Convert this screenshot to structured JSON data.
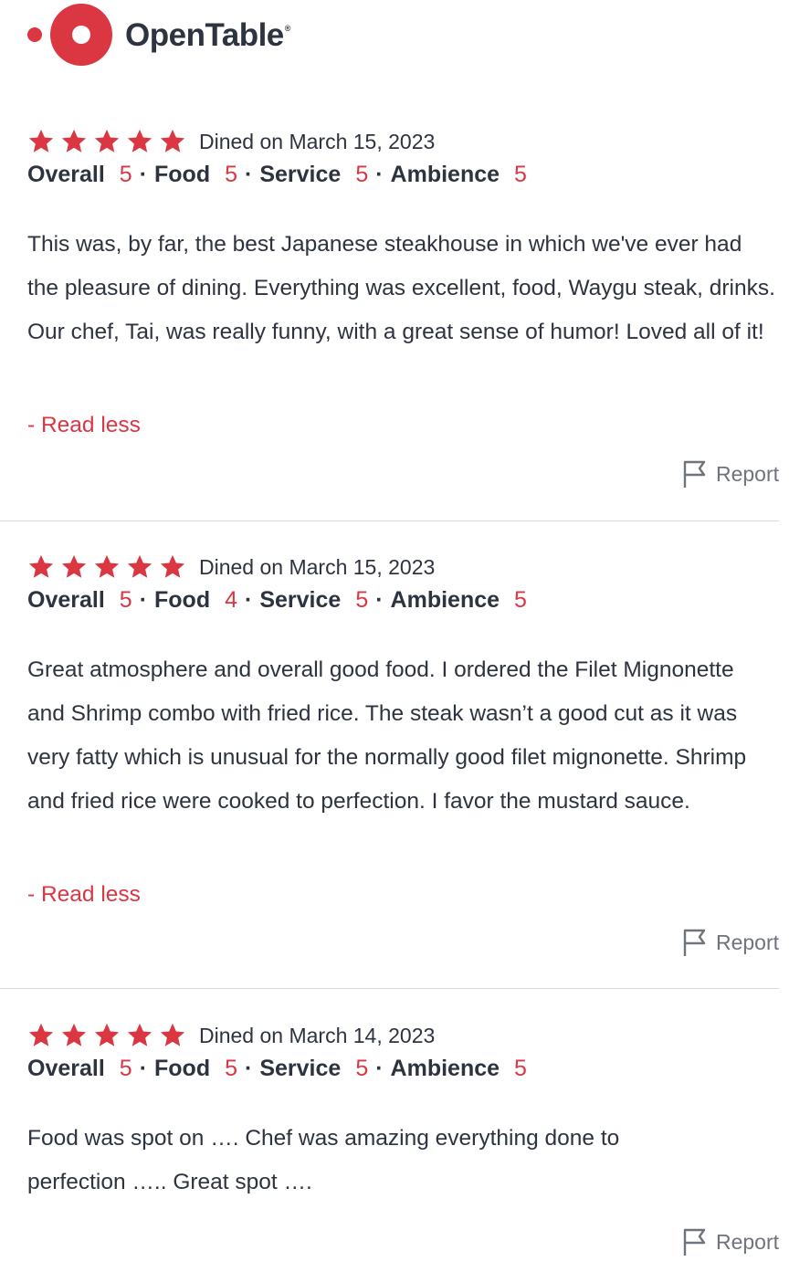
{
  "brand": {
    "name": "OpenTable",
    "reg_mark": "®",
    "color": "#da3743"
  },
  "reviews": [
    {
      "stars": 5,
      "dined": "Dined on March 15, 2023",
      "ratings": [
        {
          "label": "Overall",
          "value": "5"
        },
        {
          "label": "Food",
          "value": "5"
        },
        {
          "label": "Service",
          "value": "5"
        },
        {
          "label": "Ambience",
          "value": "5"
        }
      ],
      "text": "This was, by far, the best Japanese steakhouse in which we've ever had the pleasure of dining. Everything was excellent, food, Waygu steak, drinks. Our chef, Tai, was really funny, with a great sense of humor! Loved all of it!",
      "read_less": "- Read less",
      "report": "Report"
    },
    {
      "stars": 5,
      "dined": "Dined on March 15, 2023",
      "ratings": [
        {
          "label": "Overall",
          "value": "5"
        },
        {
          "label": "Food",
          "value": "4"
        },
        {
          "label": "Service",
          "value": "5"
        },
        {
          "label": "Ambience",
          "value": "5"
        }
      ],
      "text": "Great atmosphere and overall good food. I ordered the Filet Mignonette and Shrimp combo with fried rice. The steak wasn’t a good cut as it was very fatty which is unusual for the normally good filet mignonette. Shrimp and fried rice were cooked to perfection. I favor the mustard sauce.",
      "read_less": "- Read less",
      "report": "Report"
    },
    {
      "stars": 5,
      "dined": "Dined on March 14, 2023",
      "ratings": [
        {
          "label": "Overall",
          "value": "5"
        },
        {
          "label": "Food",
          "value": "5"
        },
        {
          "label": "Service",
          "value": "5"
        },
        {
          "label": "Ambience",
          "value": "5"
        }
      ],
      "text": "Food was spot on …. Chef was amazing everything done to perfection ….. Great spot ….",
      "report": "Report"
    }
  ],
  "icons": {
    "star": "star-icon",
    "report": "flag-icon"
  },
  "colors": {
    "accent": "#da3743",
    "text": "#2d333f",
    "muted": "#6f737b",
    "divider": "#d8d9db"
  }
}
